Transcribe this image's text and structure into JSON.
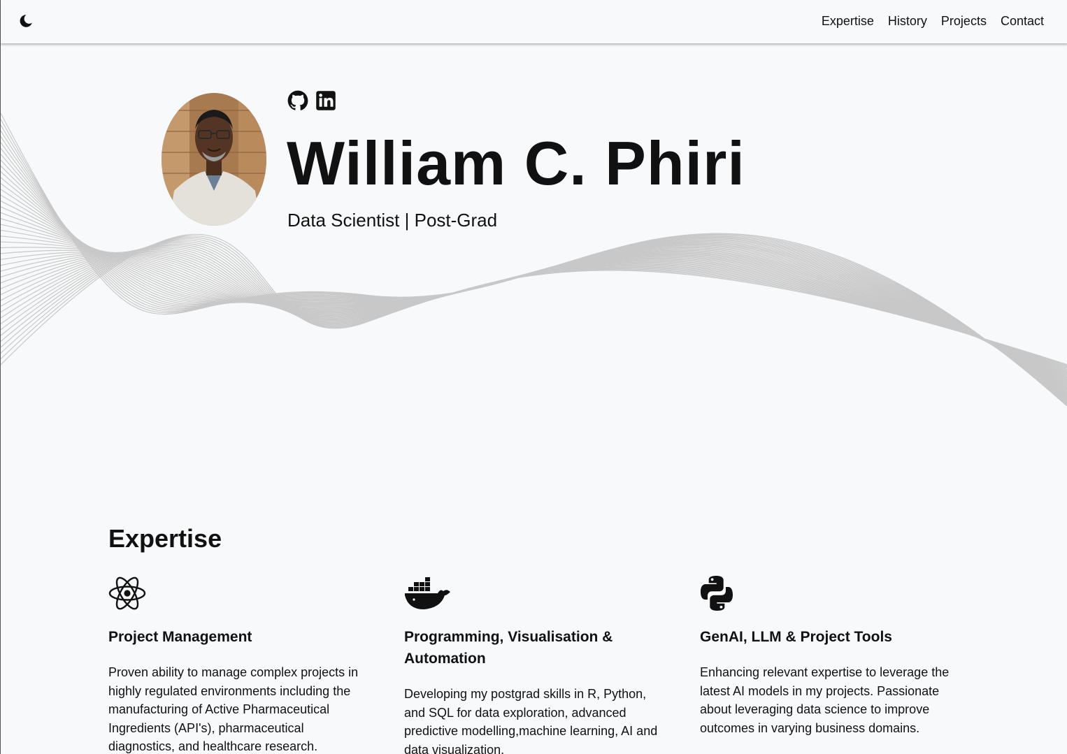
{
  "nav": {
    "links": [
      "Expertise",
      "History",
      "Projects",
      "Contact"
    ]
  },
  "icons": {
    "theme_toggle": "moon-icon",
    "social": [
      "github-icon",
      "linkedin-icon"
    ]
  },
  "hero": {
    "name": "William C. Phiri",
    "subtitle": "Data Scientist | Post-Grad"
  },
  "expertise": {
    "title": "Expertise",
    "cards": [
      {
        "icon": "react-atom-icon",
        "title": "Project Management",
        "text": "Proven ability to manage complex projects in highly regulated environments including the manufacturing of Active Pharmaceutical Ingredients (API's), pharmaceutical diagnostics, and healthcare research."
      },
      {
        "icon": "docker-whale-icon",
        "title": "Programming, Visualisation & Automation",
        "text": "Developing my postgrad skills in R, Python, and SQL for data exploration, advanced predictive modelling,machine learning, AI and data visualization."
      },
      {
        "icon": "python-icon",
        "title": "GenAI, LLM & Project Tools",
        "text": "Enhancing relevant expertise to leverage the latest AI models in my projects. Passionate about leveraging data science to improve outcomes in varying business domains."
      }
    ]
  },
  "colors": {
    "background": "#f8f9fa",
    "text": "#111111",
    "wave_lines": "#c8c8c8"
  }
}
